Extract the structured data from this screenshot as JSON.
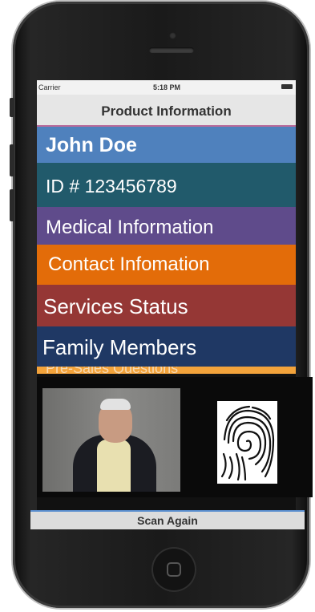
{
  "statusbar": {
    "carrier": "Carrier",
    "time": "5:18 PM"
  },
  "navbar": {
    "title": "Product Information"
  },
  "rows": [
    {
      "label": "John Doe",
      "color": "#4f81bd"
    },
    {
      "label": "ID # 123456789",
      "color": "#215a6b"
    },
    {
      "label": "Medical  Information",
      "color": "#5f4b8b"
    },
    {
      "label": "Contact Infomation",
      "color": "#e36c09"
    },
    {
      "label": "Services Status",
      "color": "#953735"
    },
    {
      "label": "Family Members",
      "color": "#1f3864"
    },
    {
      "label": "Pre-Sales Questions",
      "color": "#f3a33b"
    }
  ],
  "images": {
    "photo": "person-photo",
    "fingerprint": "fingerprint-icon"
  },
  "footer": {
    "scan_label": "Scan Again"
  }
}
